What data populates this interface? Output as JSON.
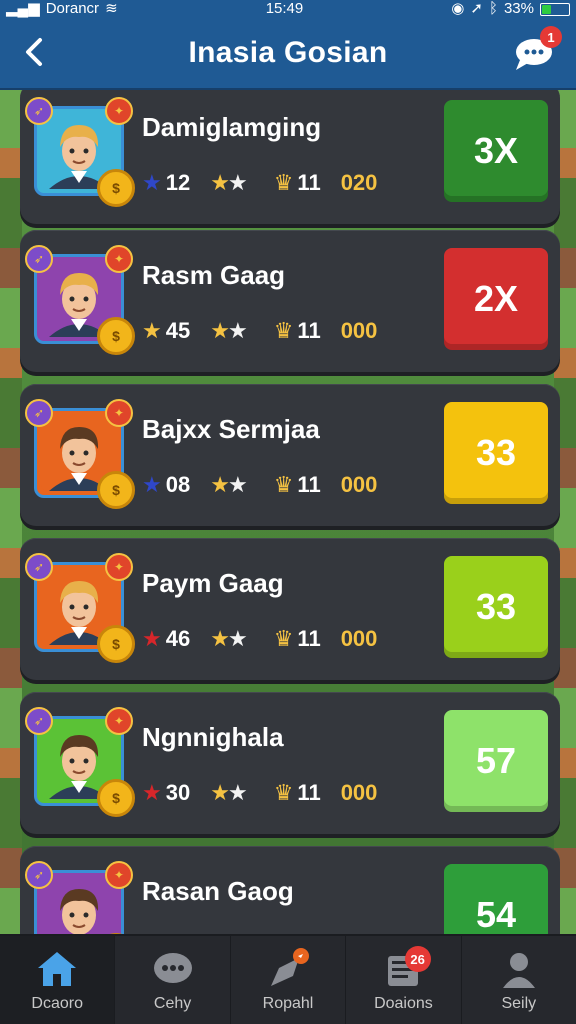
{
  "status_bar": {
    "carrier": "Dorancr",
    "time": "15:49",
    "battery": "33%",
    "battery_level": 0.33
  },
  "header": {
    "title": "Inasia Gosian",
    "chat_badge": "1"
  },
  "players": [
    {
      "name": "Damiglamging",
      "stat1_icon": "blue-star-icon",
      "stat1": "12",
      "stat3": "11",
      "stat4": "020",
      "multiplier": "3X",
      "color": "#2e8b2e",
      "avatar_bg": "#3fb5d8",
      "hair": "#e8b04a"
    },
    {
      "name": "Rasm Gaag",
      "stat1_icon": "gold-star-icon",
      "stat1": "45",
      "stat3": "11",
      "stat4": "000",
      "multiplier": "2X",
      "color": "#d32f2f",
      "avatar_bg": "#8e44ad",
      "hair": "#e8b04a"
    },
    {
      "name": "Bajxx Sermjaa",
      "stat1_icon": "blue-star-icon",
      "stat1": "08",
      "stat3": "11",
      "stat4": "000",
      "multiplier": "33",
      "color": "#f4c20d",
      "avatar_bg": "#e8651f",
      "hair": "#5a3a22"
    },
    {
      "name": "Paym Gaag",
      "stat1_icon": "red-star-icon",
      "stat1": "46",
      "stat3": "11",
      "stat4": "000",
      "multiplier": "33",
      "color": "#9ad01b",
      "avatar_bg": "#e8651f",
      "hair": "#e8b04a"
    },
    {
      "name": "Ngnnighala",
      "stat1_icon": "red-star-icon",
      "stat1": "30",
      "stat3": "11",
      "stat4": "000",
      "multiplier": "57",
      "color": "#8ee26a",
      "avatar_bg": "#5bc236",
      "hair": "#5a3a22"
    },
    {
      "name": "Rasan Gaog",
      "stat1_icon": "red-star-icon",
      "stat1": "",
      "stat3": "",
      "stat4": "",
      "multiplier": "54",
      "color": "#2e9e3a",
      "avatar_bg": "#8e44ad",
      "hair": "#5a3a22"
    }
  ],
  "nav": [
    {
      "label": "Dcaoro",
      "icon": "home-icon",
      "badge": ""
    },
    {
      "label": "Cehy",
      "icon": "chat-bubble-icon",
      "badge": ""
    },
    {
      "label": "Ropahl",
      "icon": "rocket-icon",
      "badge": ""
    },
    {
      "label": "Doaions",
      "icon": "newspaper-icon",
      "badge": "26"
    },
    {
      "label": "Seily",
      "icon": "profile-icon",
      "badge": ""
    }
  ]
}
